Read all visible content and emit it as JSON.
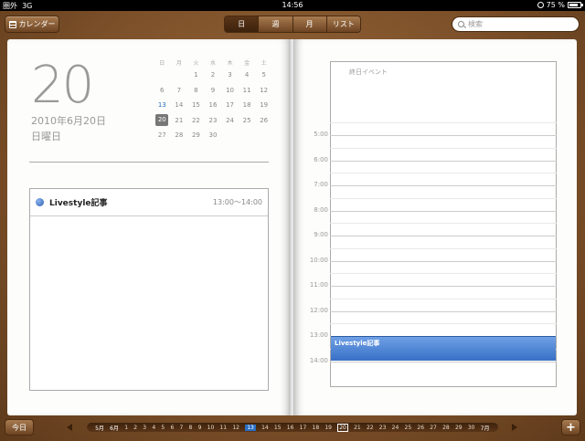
{
  "status": {
    "carrier": "圏外",
    "network": "3G",
    "time": "14:56",
    "battery": "75 %"
  },
  "toolbar": {
    "calendars_label": "カレンダー",
    "search_placeholder": "検索",
    "tabs": [
      {
        "label": "日"
      },
      {
        "label": "週"
      },
      {
        "label": "月"
      },
      {
        "label": "リスト"
      }
    ]
  },
  "day": {
    "number": "20",
    "date": "2010年6月20日",
    "weekday": "日曜日"
  },
  "mini_calendar": {
    "weekdays": [
      "日",
      "月",
      "火",
      "水",
      "木",
      "金",
      "土"
    ],
    "weeks": [
      [
        "",
        "",
        "1",
        "2",
        "3",
        "4",
        "5"
      ],
      [
        "6",
        "7",
        "8",
        "9",
        "10",
        "11",
        "12"
      ],
      [
        "13",
        "14",
        "15",
        "16",
        "17",
        "18",
        "19"
      ],
      [
        "20",
        "21",
        "22",
        "23",
        "24",
        "25",
        "26"
      ],
      [
        "27",
        "28",
        "29",
        "30",
        "",
        "",
        ""
      ]
    ]
  },
  "event": {
    "title": "Livestyle記事",
    "time": "13:00～14:00",
    "color": "#3870c6"
  },
  "allday_label": "終日イベント",
  "hours": [
    "5:00",
    "6:00",
    "7:00",
    "8:00",
    "9:00",
    "10:00",
    "11:00",
    "12:00",
    "13:00",
    "14:00"
  ],
  "bottom": {
    "today_label": "今日",
    "add_label": "+",
    "strip": [
      "5月",
      "6月",
      "1",
      "2",
      "3",
      "4",
      "5",
      "6",
      "7",
      "8",
      "9",
      "10",
      "11",
      "12",
      "13",
      "14",
      "15",
      "16",
      "17",
      "18",
      "19",
      "20",
      "21",
      "22",
      "23",
      "24",
      "25",
      "26",
      "27",
      "28",
      "29",
      "30",
      "7月"
    ]
  }
}
